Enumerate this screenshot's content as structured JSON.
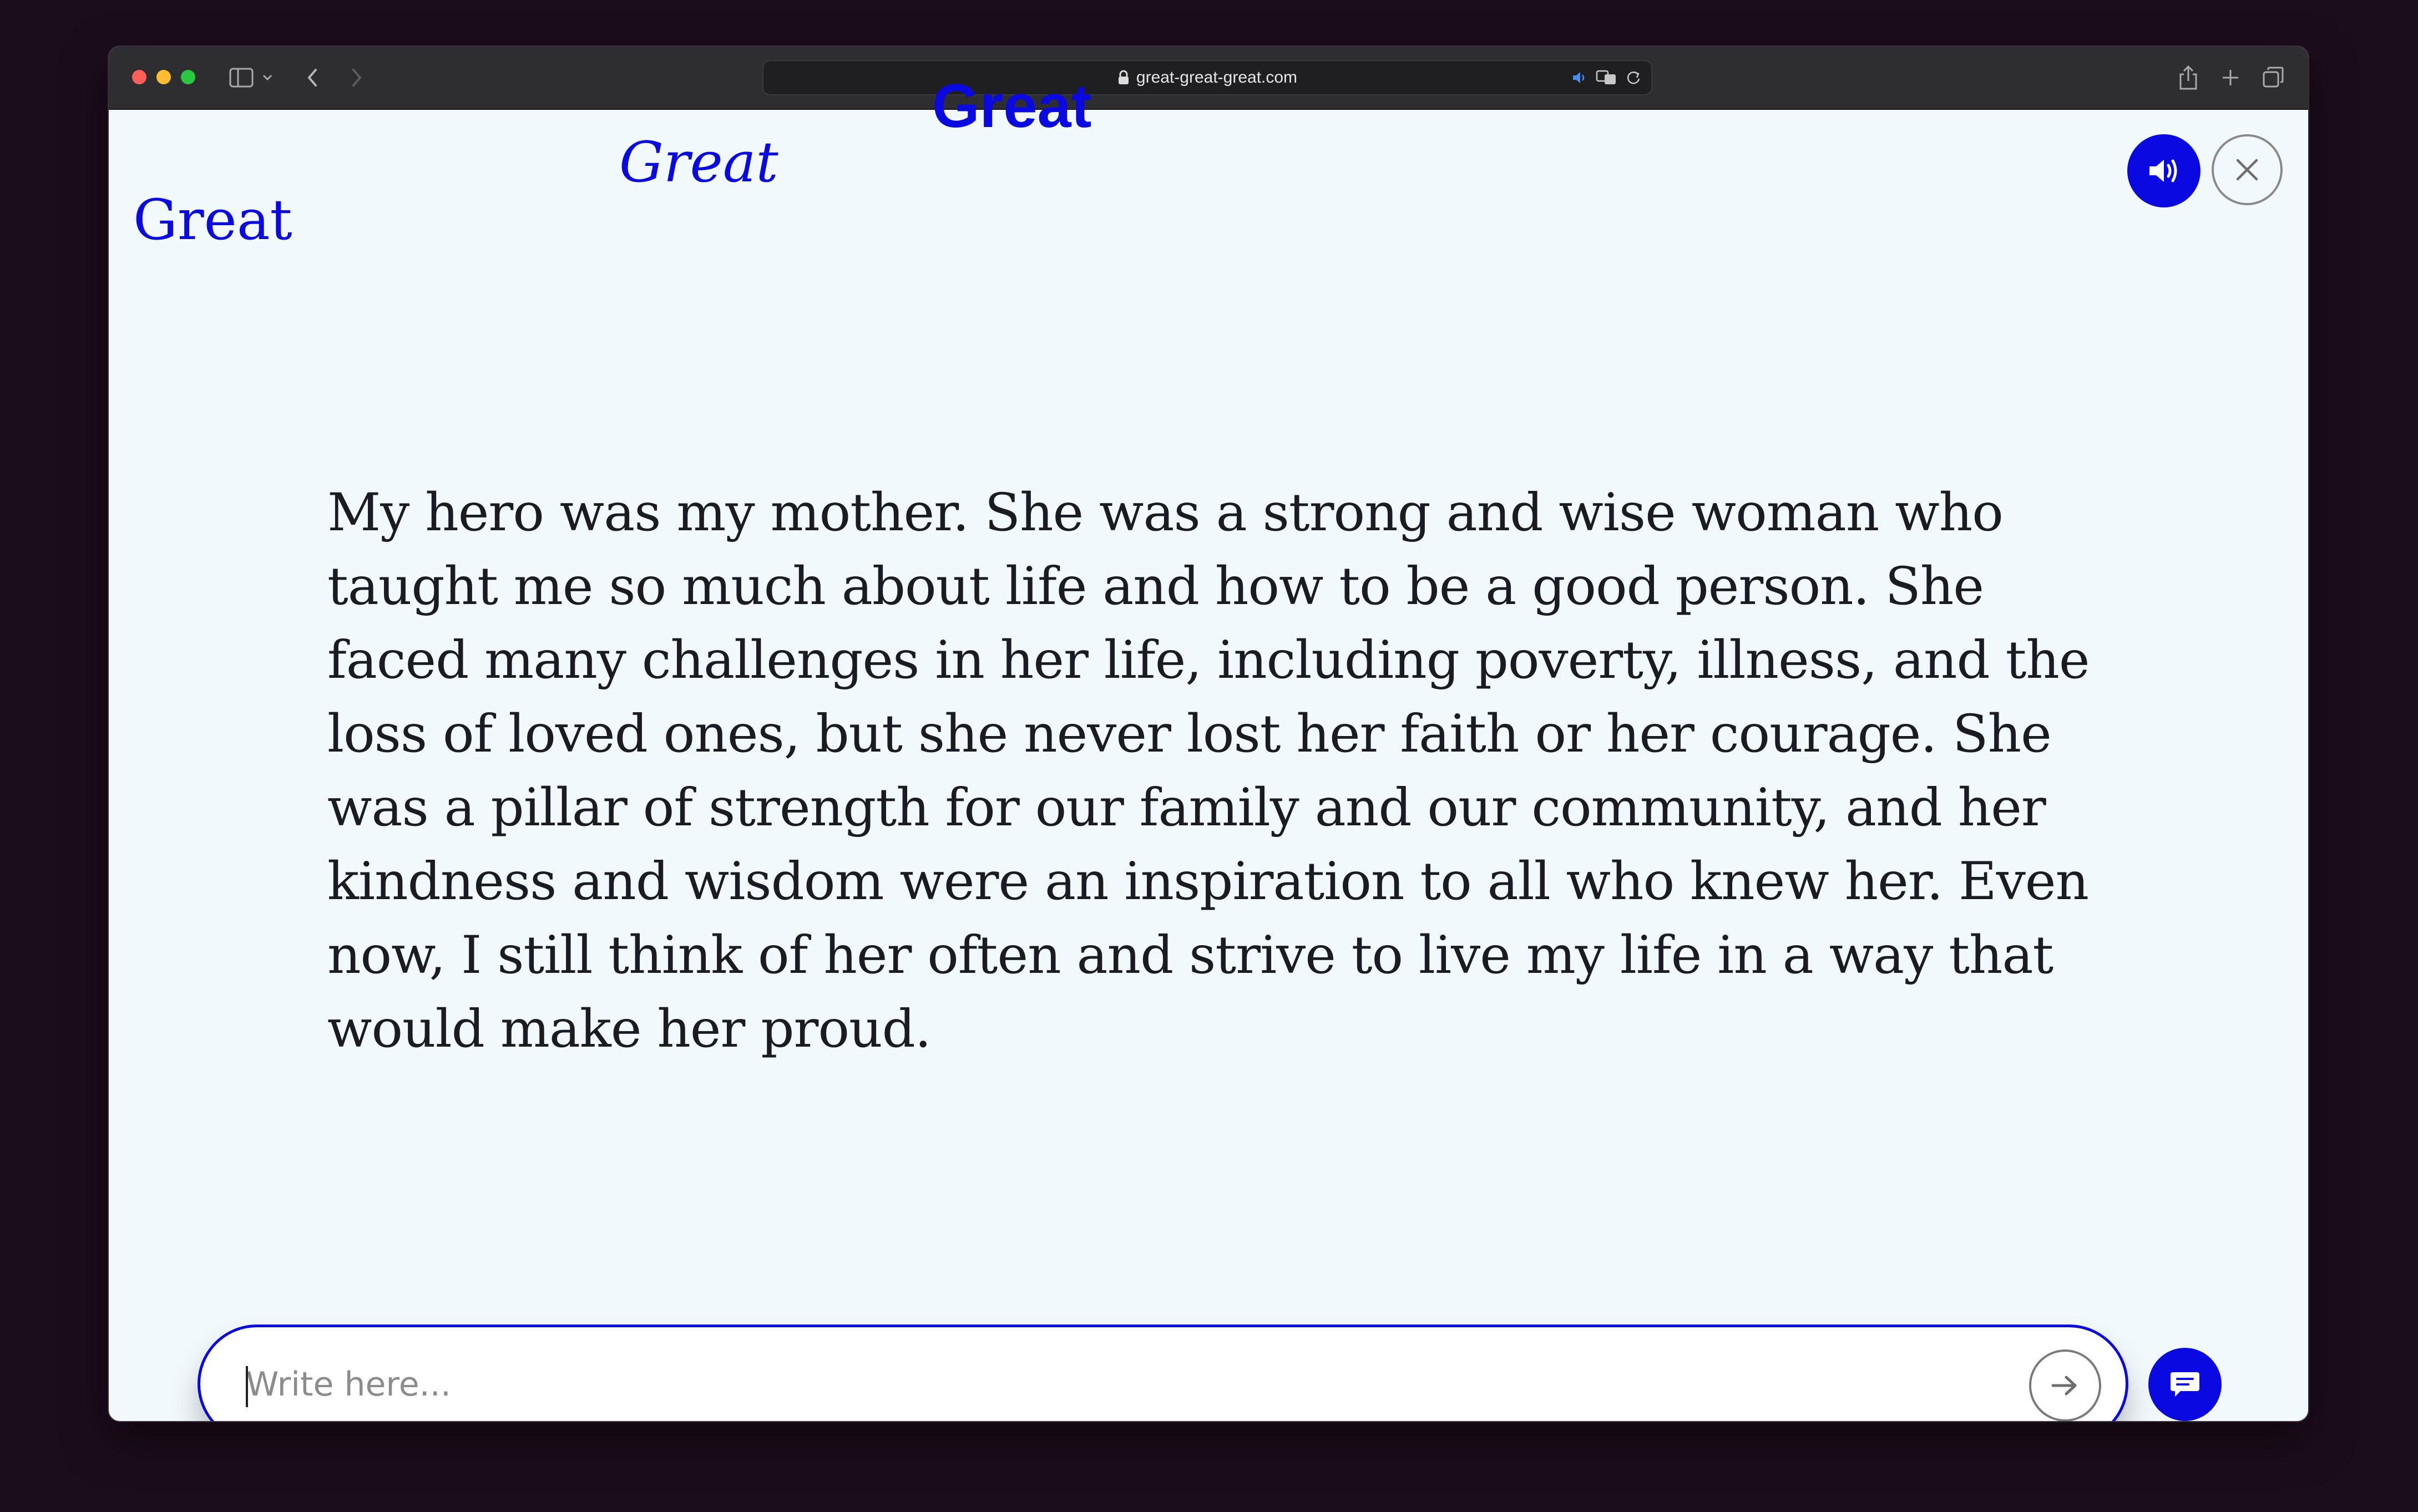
{
  "browser": {
    "url": "great-great-great.com",
    "icons": {
      "sidebar": "sidebar-icon",
      "back": "chevron-left-icon",
      "forward": "chevron-right-icon",
      "lock": "lock-icon",
      "audio": "speaker-icon",
      "translate": "translate-icon",
      "reload": "reload-icon",
      "share": "share-icon",
      "new_tab": "plus-icon",
      "tabs": "tab-overview-icon"
    }
  },
  "page": {
    "floating_words": [
      "Great",
      "Great",
      "Great"
    ],
    "story_text": "My hero was my mother. She was a strong and wise woman who taught me so much about life and how to be a good person. She faced many challenges in her life, including poverty, illness, and the loss of loved ones, but she never lost her faith or her courage. She was a pillar of strength for our family and our community, and her kindness and wisdom were an inspiration to all who knew her. Even now, I still think of her often and strive to live my life in a way that would make her proud.",
    "input": {
      "placeholder": "Write here...",
      "value": ""
    }
  },
  "colors": {
    "accent": "#0a09e2",
    "page_bg": "#f2f9fd",
    "text": "#1b1b24"
  }
}
